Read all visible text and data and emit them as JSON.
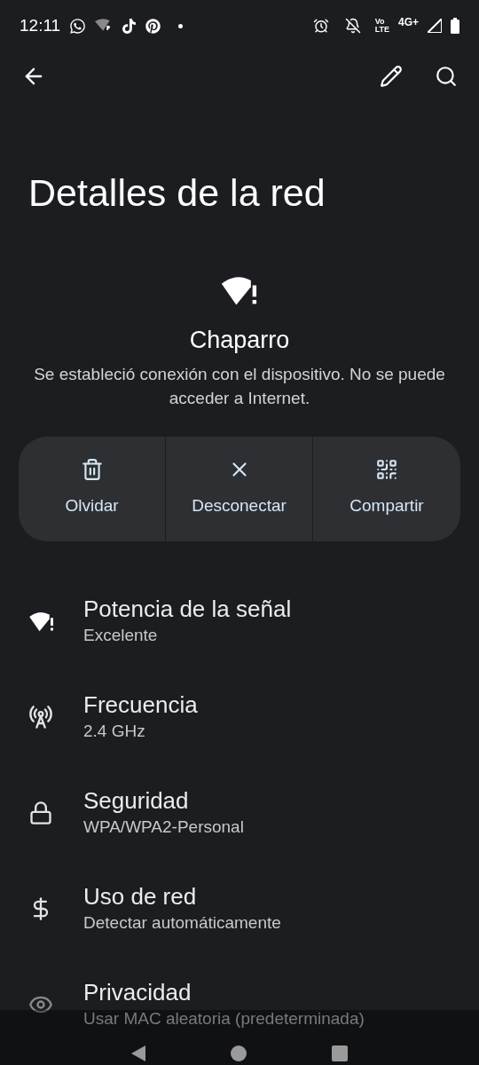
{
  "status_bar": {
    "time": "12:11",
    "volte_top": "Vo",
    "volte_bottom": "LTE",
    "network": "4G+"
  },
  "title": "Detalles de la red",
  "network": {
    "name": "Chaparro",
    "status": "Se estableció conexión con el dispositivo. No se puede acceder a Internet."
  },
  "actions": [
    {
      "label": "Olvidar"
    },
    {
      "label": "Desconectar"
    },
    {
      "label": "Compartir"
    }
  ],
  "details": [
    {
      "label": "Potencia de la señal",
      "value": "Excelente"
    },
    {
      "label": "Frecuencia",
      "value": "2.4 GHz"
    },
    {
      "label": "Seguridad",
      "value": "WPA/WPA2-Personal"
    },
    {
      "label": "Uso de red",
      "value": "Detectar automáticamente"
    },
    {
      "label": "Privacidad",
      "value": "Usar MAC aleatoria (predeterminada)"
    }
  ]
}
